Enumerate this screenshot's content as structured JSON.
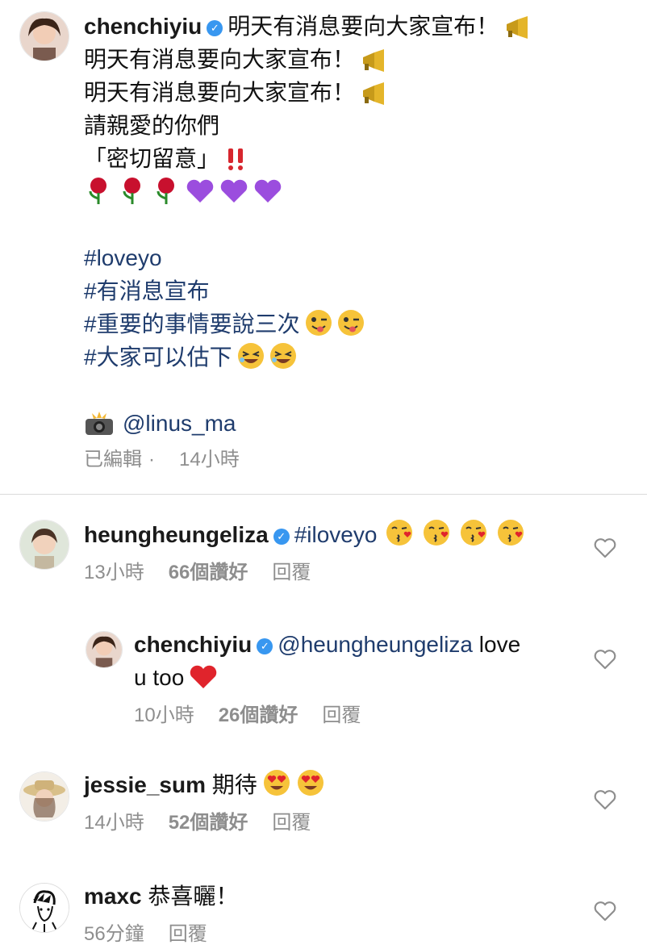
{
  "caption": {
    "username": "chenchiyiu",
    "lines": [
      "明天有消息要向大家宣布！",
      "明天有消息要向大家宣布！",
      "明天有消息要向大家宣布！",
      "請親愛的你們",
      "「密切留意」"
    ],
    "hashtags": [
      "#loveyo",
      "#有消息宣布",
      "#重要的事情要說三次",
      "#大家可以估下"
    ],
    "photo_credit": "@linus_ma",
    "edited": "已編輯",
    "time": "14小時"
  },
  "comments": [
    {
      "username": "heungheungeliza",
      "text": "#iloveyo",
      "time": "13小時",
      "likes": "66個讚好",
      "reply": "回覆"
    },
    {
      "username": "chenchiyiu",
      "mention": "@heungheungeliza",
      "text_a": "love",
      "text_b": "u too",
      "time": "10小時",
      "likes": "26個讚好",
      "reply": "回覆"
    },
    {
      "username": "jessie_sum",
      "text": "期待",
      "time": "14小時",
      "likes": "52個讚好",
      "reply": "回覆"
    },
    {
      "username": "maxc",
      "text": "恭喜曬！",
      "time": "56分鐘",
      "reply": "回覆"
    }
  ],
  "icons": {
    "verified": "verified-badge-icon",
    "megaphone": "megaphone-icon",
    "like": "heart-outline-icon",
    "camera": "camera-flash-icon"
  },
  "colors": {
    "hashtag": "#1f3c6d",
    "verified": "#3897f0",
    "meta": "#8e8e8e",
    "heart": "#e0242c",
    "rose": "#c8102e",
    "purple_heart": "#9b4dde"
  }
}
